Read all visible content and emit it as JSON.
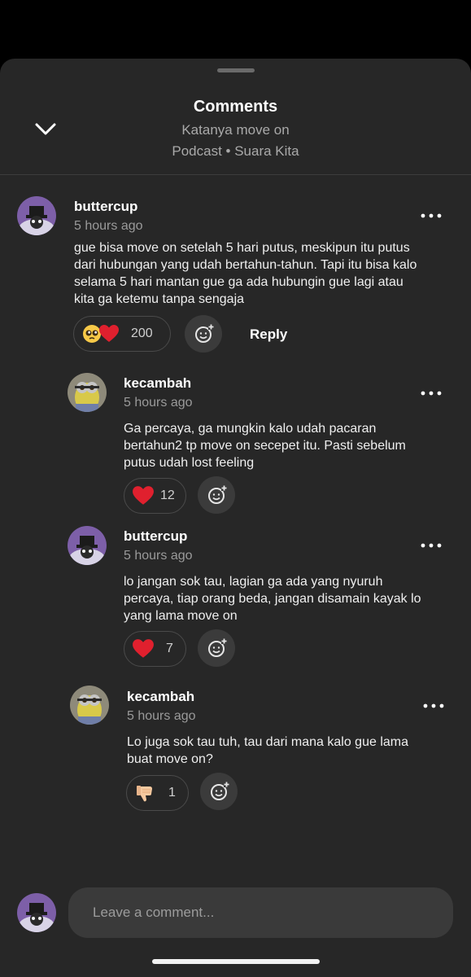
{
  "header": {
    "title": "Comments",
    "subtitle_line1": "Katanya move on",
    "subtitle_line2": "Podcast • Suara Kita"
  },
  "comments": [
    {
      "username": "buttercup",
      "time": "5 hours ago",
      "text_lines": [
        "gue bisa move on setelah 5 hari putus, meskipun itu putus",
        "dari hubungan yang udah bertahun-tahun. Tapi itu bisa kalo",
        "selama 5 hari mantan gue ga ada hubungin gue lagi atau",
        "kita ga ketemu tanpa sengaja"
      ],
      "reaction_icons": [
        "pleading-face-emoji",
        "red-heart-emoji"
      ],
      "reaction_count": "200",
      "reply_label": "Reply"
    },
    {
      "username": "kecambah",
      "time": "5 hours ago",
      "text_lines": [
        "Ga percaya, ga mungkin kalo udah pacaran",
        "bertahun2 tp move on secepet itu. Pasti sebelum",
        "putus udah lost feeling"
      ],
      "reaction_icons": [
        "red-heart-emoji"
      ],
      "reaction_count": "12"
    },
    {
      "username": "buttercup",
      "time": "5 hours ago",
      "text_lines": [
        "lo jangan sok tau, lagian ga ada yang nyuruh",
        "percaya, tiap orang beda, jangan disamain kayak lo",
        "yang lama move on"
      ],
      "reaction_icons": [
        "red-heart-emoji"
      ],
      "reaction_count": "7"
    },
    {
      "username": "kecambah",
      "time": "5 hours ago",
      "text_lines": [
        "Lo juga sok tau tuh, tau dari mana kalo gue lama",
        "buat move on?"
      ],
      "reaction_icons": [
        "thumbs-down-emoji"
      ],
      "reaction_count": "1"
    }
  ],
  "composer": {
    "placeholder": "Leave a comment..."
  },
  "icons": {
    "collapse": "chevron-down-icon",
    "more": "more-horizontal-icon",
    "add_reaction": "add-reaction-icon"
  },
  "colors": {
    "sheet_background": "#272727",
    "heart": "#e0202e",
    "muted_text": "#9a9a9a"
  }
}
